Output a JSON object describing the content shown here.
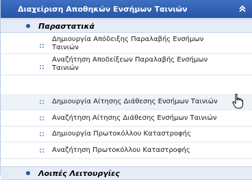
{
  "panel": {
    "title": "Διαχείριση Αποθηκών Ενσήμων Ταινιών",
    "collapse_icon": "double-chevron-up-icon"
  },
  "sections": [
    {
      "label": "Παραστατικά"
    },
    {
      "label": "Λοιπές Λειτουργίες"
    }
  ],
  "items": [
    {
      "label_line1": "Δημιουργία Απόδειξης Παραλαβής Ενσήμων",
      "label_line2": "Ταινιών"
    },
    {
      "label_line1": "Αναζήτηση Αποδείξεων Παραλαβής Ενσήμων",
      "label_line2": "Ταινιών"
    },
    {
      "label": "Δημιουργία Αίτησης Διάθεσης Ενσήμων Ταινιών"
    },
    {
      "label": "Αναζήτηση Αίτησης Διάθεσης Ενσήμων Ταινιών"
    },
    {
      "label": "Δημιουργία Πρωτοκόλλου Καταστροφής"
    },
    {
      "label": "Αναζήτηση Πρωτοκόλλου Καταστροφής"
    }
  ],
  "colors": {
    "header_bg": "#2f5fb1",
    "section_bg": "#e6ecf6",
    "bullet": "#2a57a6",
    "item_icon": "#7fa0d0"
  },
  "cursor_icon": "hand-pointer-icon"
}
